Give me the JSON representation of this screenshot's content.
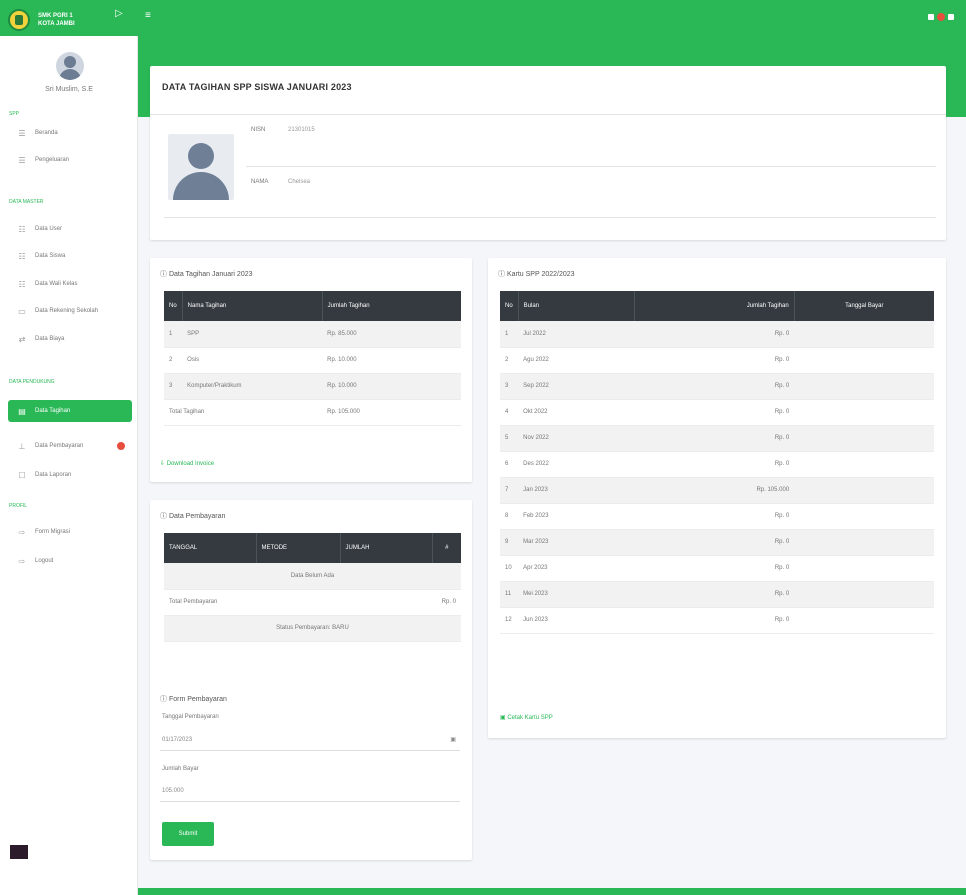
{
  "header": {
    "brand_line1": "SMK PGRI 1",
    "brand_line2": "KOTA JAMBI",
    "brand_arrow": "▷",
    "toggle_icon": "menu-icon"
  },
  "sidebar": {
    "user_name": "Sri Muslim, S.E",
    "sections": [
      "SPP",
      "DATA MASTER",
      "DATA PENDUKUNG",
      "PROFIL"
    ],
    "items": [
      {
        "icon": "☰",
        "label": "Beranda"
      },
      {
        "icon": "☰",
        "label": "Pengeluaran"
      },
      {
        "icon": "☷",
        "label": "Data User"
      },
      {
        "icon": "☷",
        "label": "Data Siswa"
      },
      {
        "icon": "☷",
        "label": "Data Wali Kelas"
      },
      {
        "icon": "▭",
        "label": "Data Rekening Sekolah"
      },
      {
        "icon": "⇄",
        "label": "Data Biaya"
      },
      {
        "icon": "▤",
        "label": "Data Tagihan"
      },
      {
        "icon": "⊥",
        "label": "Data Pembayaran"
      },
      {
        "icon": "☐",
        "label": "Data Laporan"
      },
      {
        "icon": "⇨",
        "label": "Form Migrasi"
      },
      {
        "icon": "⇨",
        "label": "Logout"
      }
    ]
  },
  "page": {
    "title": "DATA TAGIHAN SPP SISWA JANUARI 2023",
    "nisn_key": "NISN",
    "nisn_val": "21301015",
    "nama_key": "NAMA",
    "nama_val": "Chelsea"
  },
  "tagihan": {
    "title": "Data Tagihan Januari 2023",
    "headers": [
      "No",
      "Nama Tagihan",
      "Jumlah Tagihan"
    ],
    "rows": [
      [
        "1",
        "SPP",
        "Rp. 85.000"
      ],
      [
        "2",
        "Osis",
        "Rp. 10.000"
      ],
      [
        "3",
        "Komputer/Praktikum",
        "Rp. 10.000"
      ]
    ],
    "total_label": "Total Tagihan",
    "total_value": "Rp. 105.000",
    "download_link": "Download Invoice"
  },
  "pembayaran": {
    "title": "Data Pembayaran",
    "headers": [
      "TANGGAL",
      "METODE",
      "JUMLAH",
      "#"
    ],
    "empty": "Data Belum Ada",
    "total_label": "Total Pembayaran",
    "total_value": "Rp. 0",
    "status": "Status Pembayaran: BARU"
  },
  "form": {
    "title": "Form Pembayaran",
    "date_label": "Tanggal Pembayaran",
    "date_value": "01/17/2023",
    "amount_label": "Jumlah Bayar",
    "amount_value": "105.000",
    "submit": "Submit"
  },
  "kartu": {
    "title": "Kartu SPP 2022/2023",
    "headers": [
      "No",
      "Bulan",
      "Jumlah Tagihan",
      "Tanggal Bayar"
    ],
    "rows": [
      [
        "1",
        "Jul 2022",
        "Rp. 0",
        ""
      ],
      [
        "2",
        "Agu 2022",
        "Rp. 0",
        ""
      ],
      [
        "3",
        "Sep 2022",
        "Rp. 0",
        ""
      ],
      [
        "4",
        "Okt 2022",
        "Rp. 0",
        ""
      ],
      [
        "5",
        "Nov 2022",
        "Rp. 0",
        ""
      ],
      [
        "6",
        "Des 2022",
        "Rp. 0",
        ""
      ],
      [
        "7",
        "Jan 2023",
        "Rp. 105.000",
        ""
      ],
      [
        "8",
        "Feb 2023",
        "Rp. 0",
        ""
      ],
      [
        "9",
        "Mar 2023",
        "Rp. 0",
        ""
      ],
      [
        "10",
        "Apr 2023",
        "Rp. 0",
        ""
      ],
      [
        "11",
        "Mei 2023",
        "Rp. 0",
        ""
      ],
      [
        "12",
        "Jun 2023",
        "Rp. 0",
        ""
      ]
    ],
    "download_link": "Cetak Kartu SPP"
  },
  "colors": {
    "accent": "#2ab856",
    "table_header": "#343a40",
    "badge": "#e74c3c"
  }
}
